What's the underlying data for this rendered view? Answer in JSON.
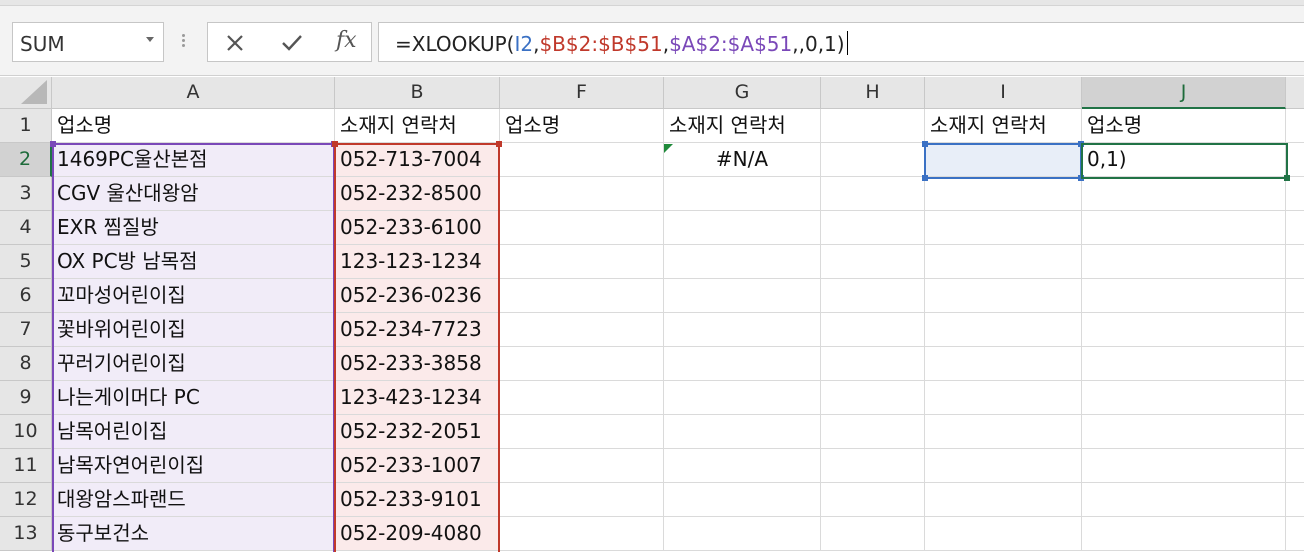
{
  "formula_bar": {
    "name_box": "SUM",
    "fx_label": "fx",
    "formula_prefix": "=XLOOKUP(",
    "formula_ref_i": "I2",
    "sep1": ",",
    "formula_ref_b": "$B$2:$B$51",
    "sep2": ",",
    "formula_ref_a": "$A$2:$A$51",
    "formula_suffix": ",,0,1)"
  },
  "columns": [
    "A",
    "B",
    "F",
    "G",
    "H",
    "I",
    "J"
  ],
  "rows": [
    "1",
    "2",
    "3",
    "4",
    "5",
    "6",
    "7",
    "8",
    "9",
    "10",
    "11",
    "12",
    "13"
  ],
  "header_row": {
    "a": "업소명",
    "b": "소재지 연락처",
    "f": "업소명",
    "g": "소재지 연락처",
    "i": "소재지 연락처",
    "j": "업소명"
  },
  "col_a": [
    "1469PC울산본점",
    "CGV 울산대왕암",
    "EXR 찜질방",
    "OX PC방 남목점",
    "꼬마성어린이집",
    "꽃바위어린이집",
    "꾸러기어린이집",
    "나는게이머다 PC",
    "남목어린이집",
    "남목자연어린이집",
    "대왕암스파랜드",
    "동구보건소"
  ],
  "col_b": [
    "052-713-7004",
    "052-232-8500",
    "052-233-6100",
    "123-123-1234",
    "052-236-0236",
    "052-234-7723",
    "052-233-3858",
    "123-423-1234",
    "052-232-2051",
    "052-233-1007",
    "052-233-9101",
    "052-209-4080"
  ],
  "g2": "#N/A",
  "j2": "0,1)",
  "colors": {
    "ref_i": "#3b71c4",
    "ref_b": "#c0392b",
    "ref_a": "#7a48b8",
    "active_border": "#217346"
  }
}
